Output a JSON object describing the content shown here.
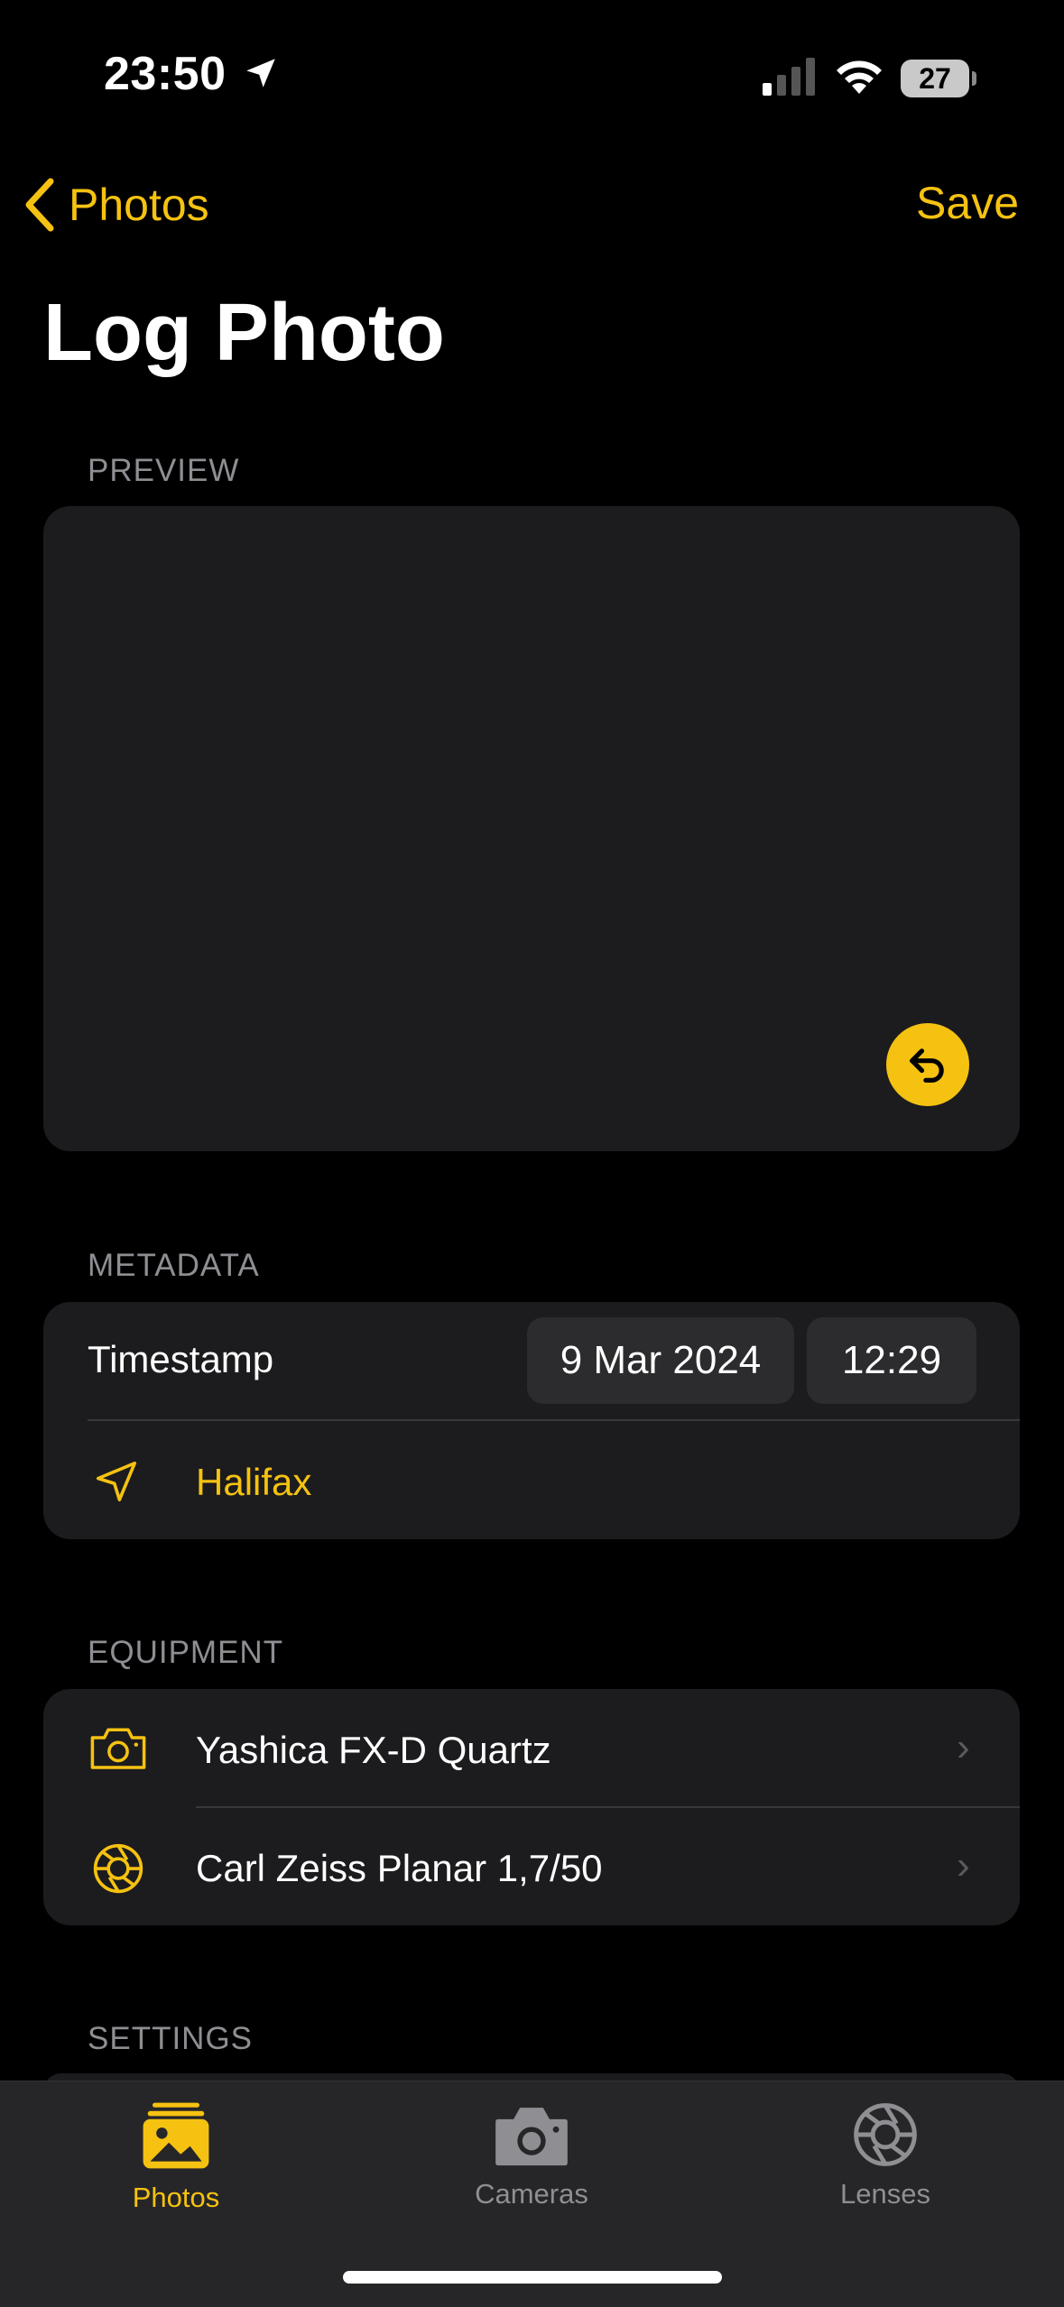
{
  "status": {
    "time": "23:50",
    "battery": "27"
  },
  "nav": {
    "back_label": "Photos",
    "save_label": "Save"
  },
  "title": "Log Photo",
  "sections": {
    "preview": "PREVIEW",
    "metadata": "METADATA",
    "equipment": "EQUIPMENT",
    "settings": "SETTINGS"
  },
  "metadata": {
    "timestamp_label": "Timestamp",
    "date": "9 Mar 2024",
    "time": "12:29",
    "location": "Halifax"
  },
  "equipment": {
    "camera": "Yashica FX-D Quartz",
    "lens": "Carl Zeiss Planar 1,7/50"
  },
  "tabs": [
    {
      "label": "Photos",
      "icon": "photos-icon",
      "active": true
    },
    {
      "label": "Cameras",
      "icon": "camera-icon",
      "active": false
    },
    {
      "label": "Lenses",
      "icon": "aperture-icon",
      "active": false
    }
  ],
  "colors": {
    "accent": "#f5c211",
    "card": "#1c1c1e",
    "background": "#000000",
    "inactive_tab": "#8e8e93"
  }
}
